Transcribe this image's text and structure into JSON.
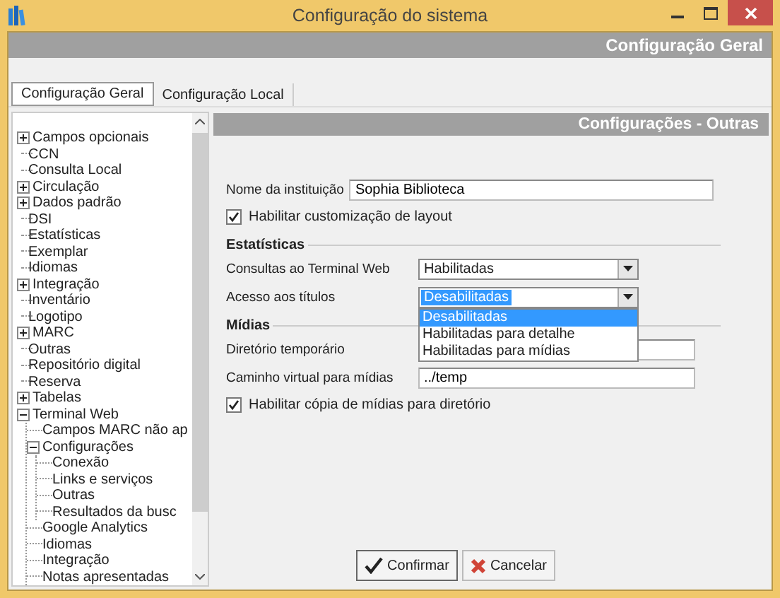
{
  "window": {
    "title": "Configuração do sistema"
  },
  "banner": {
    "title": "Configuração Geral"
  },
  "tabs": [
    {
      "label": "Configuração Geral",
      "selected": true
    },
    {
      "label": "Configuração Local",
      "selected": false
    }
  ],
  "tree": {
    "items": [
      {
        "label": "Campos opcionais",
        "expanded": false
      },
      {
        "label": "CCN"
      },
      {
        "label": "Consulta Local"
      },
      {
        "label": "Circulação",
        "expanded": false
      },
      {
        "label": "Dados padrão",
        "expanded": false
      },
      {
        "label": "DSI"
      },
      {
        "label": "Estatísticas"
      },
      {
        "label": "Exemplar"
      },
      {
        "label": "Idiomas"
      },
      {
        "label": "Integração",
        "expanded": false
      },
      {
        "label": "Inventário"
      },
      {
        "label": "Logotipo"
      },
      {
        "label": "MARC",
        "expanded": false
      },
      {
        "label": "Outras"
      },
      {
        "label": "Repositório digital"
      },
      {
        "label": "Reserva"
      },
      {
        "label": "Tabelas",
        "expanded": false
      },
      {
        "label": "Terminal Web",
        "expanded": true,
        "children": [
          {
            "label": "Campos MARC não ap"
          },
          {
            "label": "Configurações",
            "expanded": true,
            "children": [
              {
                "label": "Conexão"
              },
              {
                "label": "Links e serviços"
              },
              {
                "label": "Outras"
              },
              {
                "label": "Resultados da busc"
              }
            ]
          },
          {
            "label": "Google Analytics"
          },
          {
            "label": "Idiomas"
          },
          {
            "label": "Integração"
          },
          {
            "label": "Notas apresentadas"
          }
        ]
      }
    ]
  },
  "panel": {
    "title": "Configurações - Outras",
    "form": [
      {
        "kind": "text",
        "label": "Nome da instituição",
        "value": "Sophia Biblioteca"
      },
      {
        "kind": "checkbox",
        "label": "Habilitar customização de layout",
        "checked": true
      },
      {
        "kind": "section",
        "label": "Estatísticas"
      },
      {
        "kind": "select",
        "label": "Consultas ao Terminal Web",
        "value": "Habilitadas",
        "open": false
      },
      {
        "kind": "select",
        "label": "Acesso aos títulos",
        "value": "Desabilitadas",
        "open": true,
        "options": [
          {
            "label": "Desabilitadas",
            "selected": true
          },
          {
            "label": "Habilitadas para detalhe",
            "selected": false
          },
          {
            "label": "Habilitadas para mídias",
            "selected": false
          }
        ]
      },
      {
        "kind": "section",
        "label": "Mídias"
      },
      {
        "kind": "text",
        "label": "Diretório temporário"
      },
      {
        "kind": "text",
        "label": "Caminho virtual para mídias",
        "value": "../temp"
      },
      {
        "kind": "checkbox",
        "label": "Habilitar cópia de mídias para diretório",
        "checked": true
      }
    ]
  },
  "buttons": [
    {
      "kind": "confirm",
      "label": "Confirmar"
    },
    {
      "kind": "cancel",
      "label": "Cancelar"
    }
  ]
}
